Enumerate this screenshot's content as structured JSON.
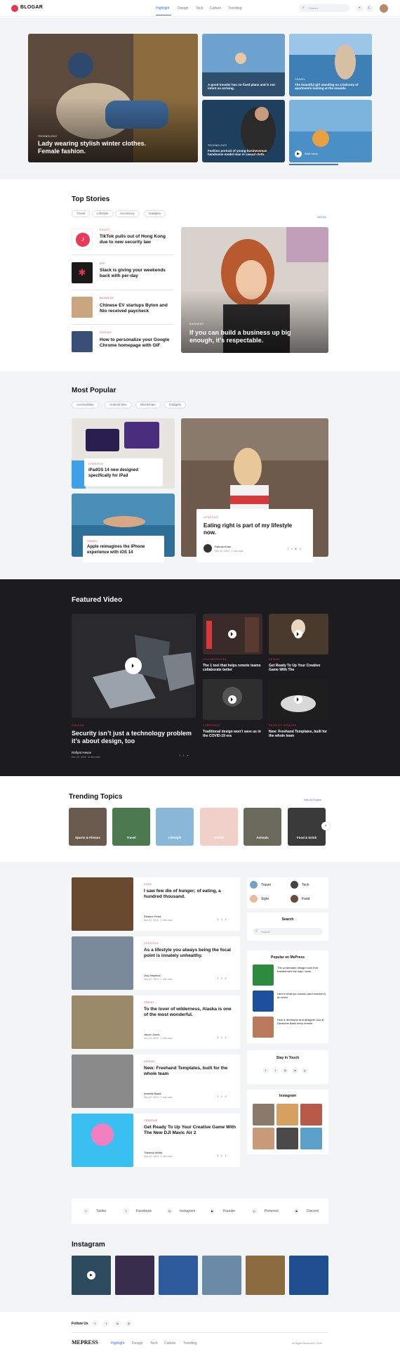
{
  "header": {
    "logo": "BLOGAR",
    "nav": [
      "Highlight",
      "Design",
      "Tech",
      "Culture",
      "Trending"
    ],
    "search_placeholder": "Search"
  },
  "hero": {
    "main": {
      "category": "TECHNOLOGY",
      "title": "Lady wearing stylish winter clothes. Female fashion."
    },
    "cards": [
      {
        "title": "A good traveler has no fixed plans and is not intent on arriving."
      },
      {
        "category": "TRAVEL",
        "title": "The beautiful girl standing on a balcony of apartments looking at the seaside."
      },
      {
        "category": "TECHNOLOGY",
        "title": "Fashion portrait of young businessman handsome model man in casual cloth."
      },
      {
        "label": "Brief news"
      }
    ]
  },
  "top_stories": {
    "title": "Top Stories",
    "tabs": [
      "Travel",
      "Lifestyle",
      "Accessory",
      "Gadgets"
    ],
    "see_all": "See All",
    "items": [
      {
        "category": "POLICY",
        "title": "TikTok pulls out of Hong Kong due to new security law"
      },
      {
        "category": "APP",
        "title": "Slack is giving your weekends back with per-day"
      },
      {
        "category": "BUSINESS",
        "title": "Chinese EV startups Byton and Nio received paycheck"
      },
      {
        "category": "GOOGLE",
        "title": "How to personalize your Google Chrome homepage with GIF"
      }
    ],
    "feature": {
      "category": "BUSINESS",
      "title": "If you can build a business up big enough, it’s respectable."
    }
  },
  "most_popular": {
    "title": "Most Popular",
    "tabs": [
      "Accessibility",
      "Android Dev",
      "Blockchain",
      "Gadgets"
    ],
    "cards": [
      {
        "category": "LIFESTYLE",
        "title": "iPadOS 14 new designed specifically for iPad"
      },
      {
        "category": "TRAVEL",
        "title": "Apple reimagines the iPhone experience with iOS 14"
      }
    ],
    "feature": {
      "category": "LIFESTYLE",
      "title": "Eating right is part of my lifestyle now.",
      "author": "Rahula Khan",
      "date": "Dec 22, 2019 · 1 min read"
    }
  },
  "featured_video": {
    "title": "Featured Video",
    "main": {
      "category": "FASHION",
      "title": "Security isn’t just a technology problem it’s about design, too",
      "author": "Rafiyat Hasan",
      "date": "Dec 22, 2019 · 8 min read"
    },
    "items": [
      {
        "category": "COLLABORATION",
        "title": "The 1 tool that helps remote teams collaborate better"
      },
      {
        "category": "DESIGN",
        "title": "Get Ready To Up Your Creative Game With The"
      },
      {
        "category": "CORPORATE",
        "title": "Traditional design won’t save us in the COVID-19 era"
      },
      {
        "category": "PRODUCT UPDATES",
        "title": "New: Freehand Templates, built for the whole team"
      }
    ]
  },
  "trending": {
    "title": "Trending Topics",
    "see_all": "See All Topics",
    "topics": [
      "Sports & Fitness",
      "Travel",
      "Lifestyle",
      "Health",
      "Animals",
      "Food & Drink"
    ]
  },
  "feed": [
    {
      "category": "FOOD",
      "title": "I saw few die of hunger; of eating, a hundred thousand.",
      "author": "Eleanor Pena",
      "date": "Nov 22, 2019 · 1 min read"
    },
    {
      "category": "LIFESTYLE",
      "title": "As a lifestyle you always being the focal point is innately unhealthy.",
      "author": "Guy Hawkins",
      "date": "Nov 22, 2019 · 1 min read"
    },
    {
      "category": "TRAVEL",
      "title": "To the lover of wilderness, Alaska is one of the most wonderful.",
      "author": "Jacob Jones",
      "date": "Nov 22, 2019 · 1 min read"
    },
    {
      "category": "DESIGN",
      "title": "New: Freehand Templates, built for the whole team",
      "author": "Annette Black",
      "date": "Nov 22, 2019 · 1 min read"
    },
    {
      "category": "CREATIVE",
      "title": "Get Ready To Up Your Creative Game With The New DJI Mavic Air 2",
      "author": "Theresa Webb",
      "date": "Nov 22, 2019 · 1 min read"
    }
  ],
  "sidebar": {
    "categories": [
      "Travel",
      "Tech",
      "Style",
      "Food"
    ],
    "search_title": "Search",
    "search_placeholder": "Search",
    "popular_title": "Popular on MePress",
    "popular": [
      "The underrated design book that transformed the way I work",
      "Here’s what you should (and shouldn’t) do when",
      "How a developer and designer duo at Deutsche Bank keep remote"
    ],
    "stay_title": "Stay In Touch",
    "instagram_title": "Instagram"
  },
  "social_bar": [
    "Twitter",
    "Facebook",
    "Instagram",
    "Youtube",
    "Pinterest",
    "Discord"
  ],
  "instagram": {
    "title": "Instagram"
  },
  "footer": {
    "follow": "Follow Us",
    "logo": "MEPRESS",
    "nav": [
      "Highlight",
      "Design",
      "Tech",
      "Culture",
      "Trending"
    ],
    "copyright": "All Rights Reserved © 2020"
  }
}
